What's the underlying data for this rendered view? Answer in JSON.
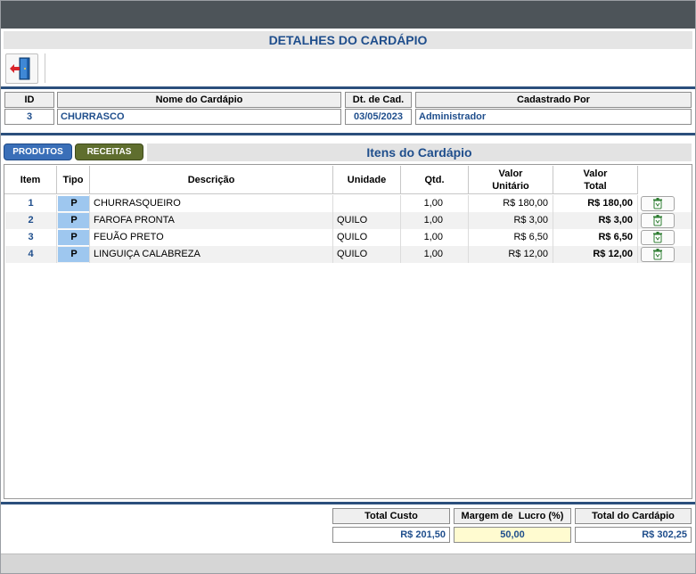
{
  "window": {
    "title": "DETALHES DO CARDÁPIO"
  },
  "toolbar": {
    "exit_icon": "exit-door-icon"
  },
  "header": {
    "labels": {
      "id": "ID",
      "name": "Nome do Cardápio",
      "date": "Dt. de Cad.",
      "created_by": "Cadastrado Por"
    },
    "values": {
      "id": "3",
      "name": "CHURRASCO",
      "date": "03/05/2023",
      "created_by": "Administrador"
    }
  },
  "tabs": [
    {
      "label": "PRODUTOS",
      "active": true,
      "color": "#3a6fb8"
    },
    {
      "label": "RECEITAS",
      "active": false,
      "color": "#5f6e2e"
    }
  ],
  "section": {
    "title": "Itens do Cardápio"
  },
  "table": {
    "columns": {
      "item": "Item",
      "tipo": "Tipo",
      "descricao": "Descrição",
      "unidade": "Unidade",
      "qtd": "Qtd.",
      "valor_unitario": "Valor\nUnitário",
      "valor_total": "Valor\nTotal"
    },
    "rows": [
      {
        "item": "1",
        "tipo": "P",
        "descricao": "CHURRASQUEIRO",
        "unidade": "",
        "qtd": "1,00",
        "valor_unitario": "R$ 180,00",
        "valor_total": "R$ 180,00"
      },
      {
        "item": "2",
        "tipo": "P",
        "descricao": "FAROFA PRONTA",
        "unidade": "QUILO",
        "qtd": "1,00",
        "valor_unitario": "R$ 3,00",
        "valor_total": "R$ 3,00"
      },
      {
        "item": "3",
        "tipo": "P",
        "descricao": "FEUÃO PRETO",
        "unidade": "QUILO",
        "qtd": "1,00",
        "valor_unitario": "R$ 6,50",
        "valor_total": "R$ 6,50"
      },
      {
        "item": "4",
        "tipo": "P",
        "descricao": "LINGUIÇA CALABREZA",
        "unidade": "QUILO",
        "qtd": "1,00",
        "valor_unitario": "R$ 12,00",
        "valor_total": "R$ 12,00"
      }
    ],
    "delete_icon": "trash-icon"
  },
  "totals": {
    "labels": {
      "custo": "Total Custo",
      "margem": "Margem de  Lucro (%)",
      "cardapio": "Total do Cardápio"
    },
    "values": {
      "custo": "R$ 201,50",
      "margem": "50,00",
      "cardapio": "R$ 302,25"
    }
  },
  "colors": {
    "title_bar": "#4d5459",
    "accent_blue": "#1f4e8c",
    "tipo_badge": "#9ec7ef",
    "margin_field": "#fffbd0"
  }
}
